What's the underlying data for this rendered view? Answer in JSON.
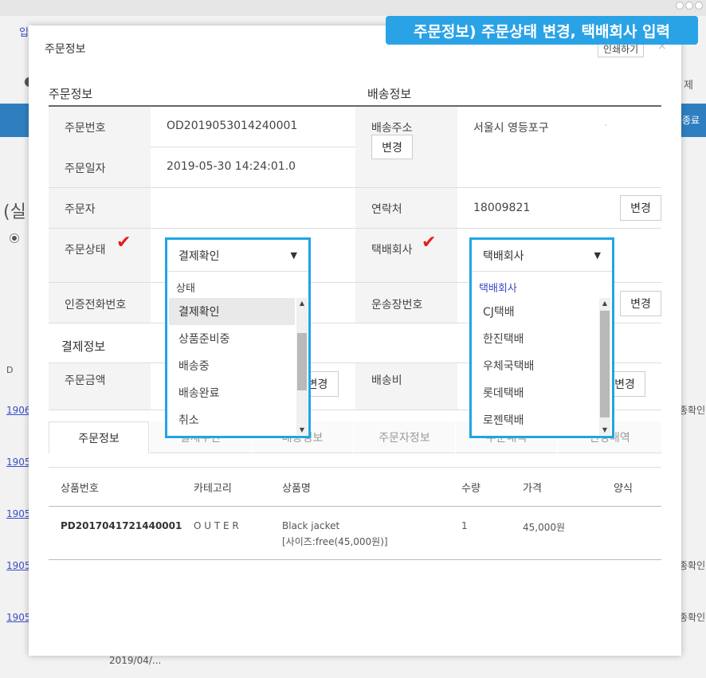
{
  "banner": "주문정보) 주문상태 변경, 택배회사 입력",
  "background": {
    "tab_left": "입",
    "bracket": "(실",
    "col_header": "D",
    "right_labels": [
      "제",
      "종료"
    ],
    "links": [
      "1906",
      "1905",
      "1905",
      "1905",
      "1905"
    ],
    "right_status": [
      "종확인",
      "종확인",
      "종확인"
    ],
    "bottom_date": "2019/04/..."
  },
  "modal": {
    "title": "주문정보",
    "print_label": "인쇄하기",
    "close": "×"
  },
  "order_info": {
    "section_title": "주문정보",
    "order_no_label": "주문번호",
    "order_no": "OD2019053014240001",
    "order_date_label": "주문일자",
    "order_date": "2019-05-30 14:24:01.0",
    "orderer_label": "주문자",
    "orderer": "",
    "status_label": "주문상태",
    "auth_phone_label": "인증전화번호"
  },
  "shipping_info": {
    "section_title": "배송정보",
    "address_label": "배송주소",
    "address": "서울시 영등포구",
    "address_extra": "·",
    "change_label": "변경",
    "contact_label": "연락처",
    "contact": "18009821",
    "courier_label": "택배회사",
    "tracking_label": "운송장번호",
    "shipping_fee_label": "배송비"
  },
  "payment_info": {
    "section_title": "결제정보",
    "amount_label": "주문금액",
    "change_label": "변경"
  },
  "status_dropdown": {
    "selected": "결제확인",
    "group_label": "상태",
    "options": [
      "결제확인",
      "상품준비중",
      "배송중",
      "배송완료",
      "취소"
    ]
  },
  "courier_dropdown": {
    "selected": "택배회사",
    "group_label": "택배회사",
    "options": [
      "CJ택배",
      "한진택배",
      "우체국택배",
      "롯데택배",
      "로젠택배"
    ]
  },
  "tabs": [
    "주문정보",
    "결제수단",
    "배송정보",
    "주문자정보",
    "주문내역",
    "변경내역"
  ],
  "product_table": {
    "headers": [
      "상품번호",
      "카테고리",
      "상품명",
      "수량",
      "가격",
      "양식"
    ],
    "rows": [
      {
        "product_no": "PD2017041721440001",
        "category": "O U T E R",
        "name": "Black jacket",
        "option": "[사이즈:free(45,000원)]",
        "qty": "1",
        "price": "45,000원",
        "form": ""
      }
    ]
  },
  "colors": {
    "banner": "#2aa3e6",
    "highlight_border": "#1ea6e3",
    "check": "#e02020",
    "bg_bar": "#2f7fc0",
    "group_label_blue": "#3a4cc8"
  }
}
